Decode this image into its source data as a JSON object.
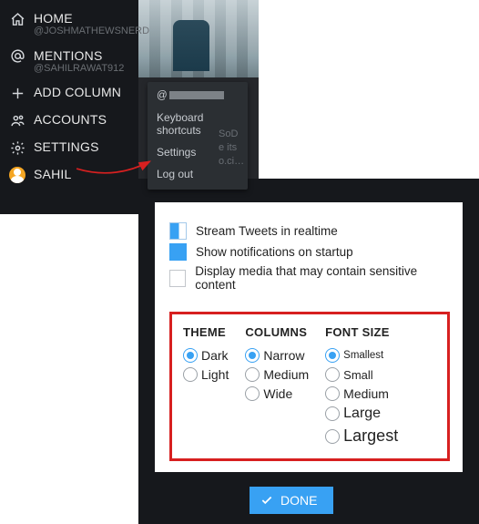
{
  "sidebar": {
    "items": [
      {
        "label": "HOME",
        "sub": "@JOSHMATHEWSNERD",
        "icon": "home-icon"
      },
      {
        "label": "MENTIONS",
        "sub": "@SAHILRAWAT912",
        "icon": "mention-icon"
      },
      {
        "label": "ADD COLUMN",
        "sub": "",
        "icon": "plus-icon"
      },
      {
        "label": "ACCOUNTS",
        "sub": "",
        "icon": "accounts-icon"
      },
      {
        "label": "SETTINGS",
        "sub": "",
        "icon": "gear-icon"
      },
      {
        "label": "SAHIL",
        "sub": "",
        "icon": "avatar-icon"
      }
    ]
  },
  "account_menu": {
    "handle_prefix": "@",
    "items": [
      {
        "label": "Keyboard shortcuts"
      },
      {
        "label": "Settings"
      },
      {
        "label": "Log out"
      }
    ]
  },
  "fragments": {
    "l1": "SoD",
    "l2": "e its",
    "l3": "o.ci…"
  },
  "settings": {
    "checkboxes": [
      {
        "label": "Stream Tweets in realtime",
        "state": "half"
      },
      {
        "label": "Show notifications on startup",
        "state": "on"
      },
      {
        "label": "Display media that may contain sensitive content",
        "state": "off"
      }
    ],
    "groups": {
      "theme": {
        "header": "THEME",
        "options": [
          "Dark",
          "Light"
        ],
        "selected": 0
      },
      "columns": {
        "header": "COLUMNS",
        "options": [
          "Narrow",
          "Medium",
          "Wide"
        ],
        "selected": 0
      },
      "fontsize": {
        "header": "FONT SIZE",
        "options": [
          "Smallest",
          "Small",
          "Medium",
          "Large",
          "Largest"
        ],
        "selected": 0
      }
    }
  },
  "done_label": "DONE"
}
